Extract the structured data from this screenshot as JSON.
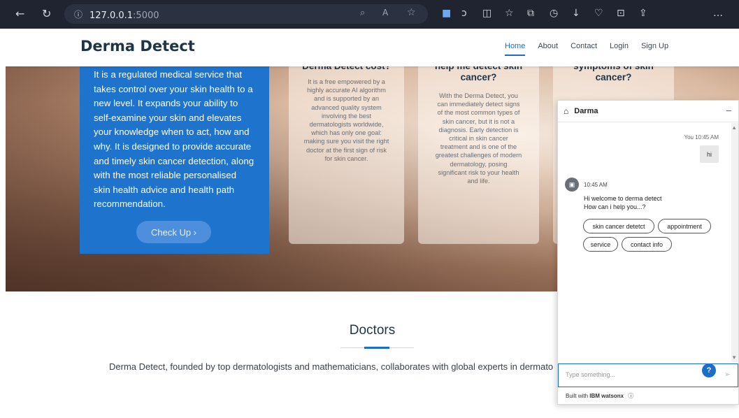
{
  "browser": {
    "url_host": "127.0.0.1",
    "url_port": ":5000",
    "icons": [
      "back-icon",
      "refresh-icon",
      "info-icon",
      "zoom-icon",
      "read-aloud-icon",
      "favorite-icon",
      "extension-icon",
      "copilot-icon",
      "split-icon",
      "favorites-icon",
      "collections-icon",
      "history-icon",
      "download-icon",
      "performance-icon",
      "screenshot-icon",
      "share-icon",
      "more-icon"
    ]
  },
  "nav": {
    "brand": "Derma Detect",
    "links": [
      "Home",
      "About",
      "Contact",
      "Login",
      "Sign Up"
    ]
  },
  "hero": {
    "blue_text_lines": [
      "It is a regulated medical service that",
      "takes control over your skin health to a",
      "new level. It expands your ability to",
      "self-examine your skin and elevates",
      "your knowledge when to act, how and",
      "why. It is designed to provide accurate",
      "and timely skin cancer detection, along",
      "with the most reliable personalised",
      "skin health advice and health path",
      "recommendation."
    ],
    "cta": "Check Up ›",
    "cards": [
      {
        "title_lines": [
          "Derma Detect cost?"
        ],
        "body_lines": [
          "It is a free empowered by a",
          "highly accurate AI algorithm",
          "and is supported by an",
          "advanced quality system",
          "involving the best",
          "dermatologists worldwide,",
          "which has only one goal:",
          "making sure you visit the right",
          "doctor at the first sign of risk",
          "for skin cancer."
        ]
      },
      {
        "title_lines": [
          "help me detect skin",
          "cancer?"
        ],
        "body_lines": [
          "With the Derma Detect, you",
          "can immediately detect signs",
          "of the most common types of",
          "skin cancer, but it is not a",
          "diagnosis. Early detection is",
          "critical in skin cancer",
          "treatment and is one of the",
          "greatest challenges of modern",
          "dermatology, posing",
          "significant risk to your health",
          "and life."
        ]
      },
      {
        "title_lines": [
          "symptoms of skin",
          "cancer?"
        ],
        "body_lines": []
      }
    ]
  },
  "doctors": {
    "title": "Doctors",
    "text": "Derma Detect, founded by top dermatologists and mathematicians, collaborates with global experts in dermato"
  },
  "chat": {
    "title": "Darma",
    "minimize": "–",
    "user_time": "You 10:45 AM",
    "user_msg": "hi",
    "bot_time": "10:45 AM",
    "bot_lines": [
      "Hi welcome to derma detect",
      "How can i help you...?"
    ],
    "chips": [
      "skin cancer detetct",
      "appointment",
      "service",
      "contact info"
    ],
    "help": "?",
    "input_placeholder": "Type something...",
    "footer_prefix": "Built with ",
    "footer_brand": "IBM watsonx"
  }
}
